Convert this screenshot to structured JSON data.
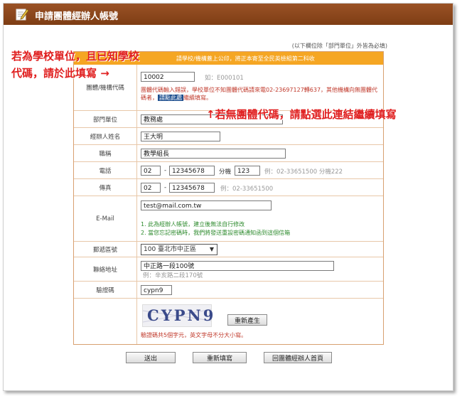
{
  "header": {
    "title": "申請團體經辦人帳號",
    "icon": "edit-icon"
  },
  "note": "(以下欄位除「部門單位」外皆為必填)",
  "banner": "請學校/機構蓋上公印，將正本寄至全民英檢組第二科收",
  "annotations": {
    "school_code_line1": "若為學校單位，且已知學校",
    "school_code_line2": "代碼，請於此填寫 →",
    "no_code": "↑若無團體代碼，請點選此連結繼續填寫"
  },
  "fields": {
    "org_code": {
      "label": "團體/機構代碼",
      "value": "10002",
      "hint": "如：E000101",
      "help_prefix": "團體代碼輸入錯誤，學校單位不知團體代碼請來電02-23697127轉637，其他機構向無團體代碼者，",
      "help_link": "請點此處",
      "help_suffix": "繼續填寫。"
    },
    "department": {
      "label": "部門單位",
      "value": "教務處"
    },
    "name": {
      "label": "經辦人姓名",
      "value": "王大明"
    },
    "position": {
      "label": "職稱",
      "value": "教學組長"
    },
    "phone": {
      "label": "電話",
      "area": "02",
      "dash": "-",
      "number": "12345678",
      "ext_label": "分機",
      "ext": "123",
      "hint": "例：02-33651500 分機222"
    },
    "fax": {
      "label": "傳真",
      "area": "02",
      "dash": "-",
      "number": "12345678",
      "hint": "例：02-33651500"
    },
    "email": {
      "label": "E-Mail",
      "value": "test@mail.com.tw",
      "note1": "1. 此為經辦人帳號，建立後無法自行修改",
      "note2": "2. 當您忘記密碼時，我們將發送重設密碼通知函到這個信箱"
    },
    "district": {
      "label": "郵遞區號",
      "value": "100 臺北市中正區"
    },
    "address": {
      "label": "聯絡地址",
      "value": "中正路一段100號",
      "hint": "例：辛亥路二段170號"
    },
    "captcha": {
      "label": "驗證碼",
      "value": "cypn9",
      "image_text": "CYPN9",
      "refresh_label": "重新產生",
      "note": "驗證碼共5個字元，英文字母不分大小寫。"
    }
  },
  "buttons": {
    "submit": "送出",
    "reset": "重新填寫",
    "home": "回團體經辦人首頁"
  }
}
